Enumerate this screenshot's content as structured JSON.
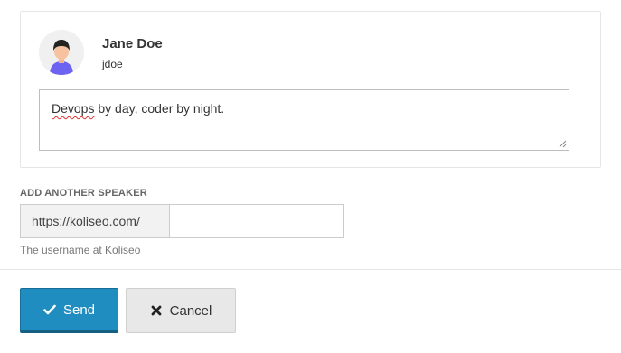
{
  "speaker": {
    "name": "Jane Doe",
    "username": "jdoe",
    "bio_first_word": "Devops",
    "bio_rest": " by day, coder by night."
  },
  "add_speaker": {
    "label": "ADD ANOTHER SPEAKER",
    "url_prefix": "https://koliseo.com/",
    "input_value": "",
    "help_text": "The username at Koliseo"
  },
  "actions": {
    "send_label": "Send",
    "send_icon": "check-icon",
    "cancel_label": "Cancel",
    "cancel_icon": "close-icon"
  },
  "colors": {
    "primary": "#1f8dbf",
    "secondary": "#e8e8e8"
  }
}
